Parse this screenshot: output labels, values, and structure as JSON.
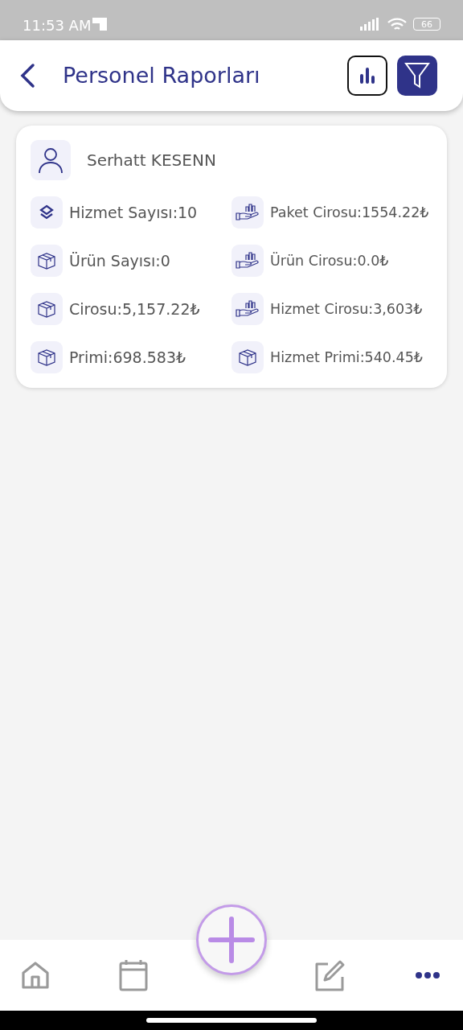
{
  "status_bar": {
    "time": "11:53 AM",
    "battery": "66"
  },
  "header": {
    "title": "Personel Raporları"
  },
  "person": {
    "name": "Serhatt KESENN"
  },
  "stats": [
    {
      "kind": "layers",
      "text": "Hizmet Sayısı:10"
    },
    {
      "kind": "hand",
      "text": "Paket Cirosu:1554.22₺"
    },
    {
      "kind": "box",
      "text": "Ürün Sayısı:0"
    },
    {
      "kind": "hand",
      "text": "Ürün Cirosu:0.0₺"
    },
    {
      "kind": "box",
      "text": "Cirosu:5,157.22₺"
    },
    {
      "kind": "hand",
      "text": "Hizmet Cirosu:3,603₺"
    },
    {
      "kind": "box",
      "text": "Primi:698.583₺"
    },
    {
      "kind": "box",
      "text": "Hizmet Primi:540.45₺"
    }
  ],
  "bottom_nav": [
    {
      "kind": "home",
      "selected": false
    },
    {
      "kind": "calendar",
      "selected": false
    },
    {
      "kind": "plus",
      "selected": false
    },
    {
      "kind": "edit",
      "selected": false
    },
    {
      "kind": "more",
      "selected": true
    }
  ]
}
